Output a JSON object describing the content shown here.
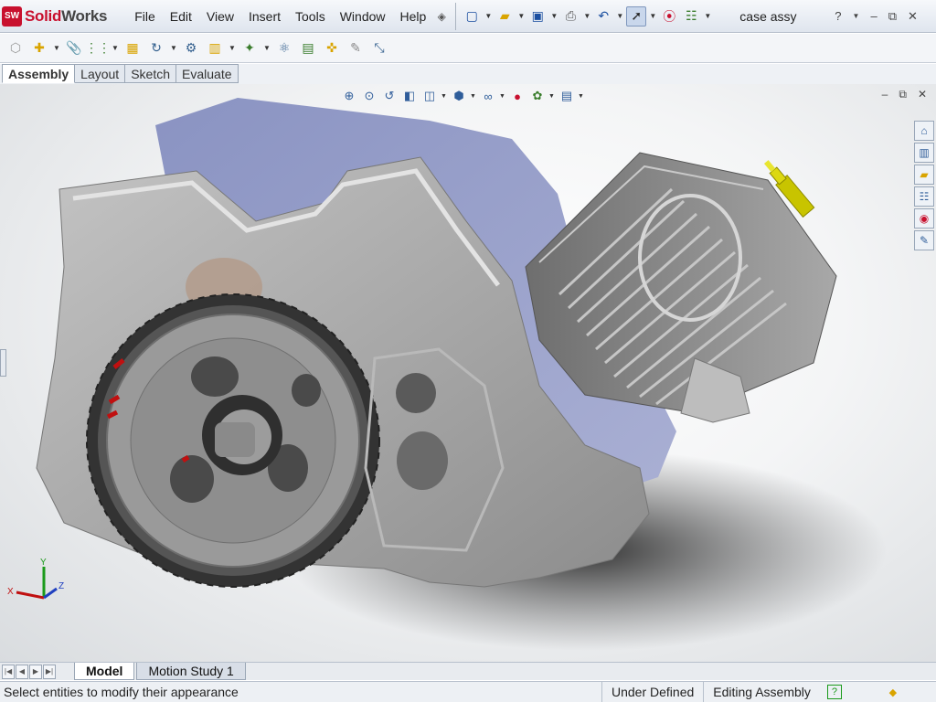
{
  "app": {
    "logo_badge": "SW",
    "logo_solid": "Solid",
    "logo_works": "Works"
  },
  "menu": [
    "File",
    "Edit",
    "View",
    "Insert",
    "Tools",
    "Window",
    "Help"
  ],
  "document": {
    "title": "case assy"
  },
  "window_controls": {
    "help": "?",
    "minimize": "–",
    "restore": "⧉",
    "close": "✕"
  },
  "tabs": [
    "Assembly",
    "Layout",
    "Sketch",
    "Evaluate"
  ],
  "active_tab": "Assembly",
  "bottom_tabs": [
    "Model",
    "Motion Study 1"
  ],
  "status": {
    "message": "Select entities to modify their appearance",
    "definition": "Under Defined",
    "mode": "Editing Assembly"
  },
  "triad": {
    "x": "X",
    "y": "Y",
    "z": "Z"
  },
  "colors": {
    "accent": "#c8102e",
    "part_grey": "#9a9a9a",
    "case_blue": "#8a93c2",
    "spark_plug": "#c8c400"
  }
}
